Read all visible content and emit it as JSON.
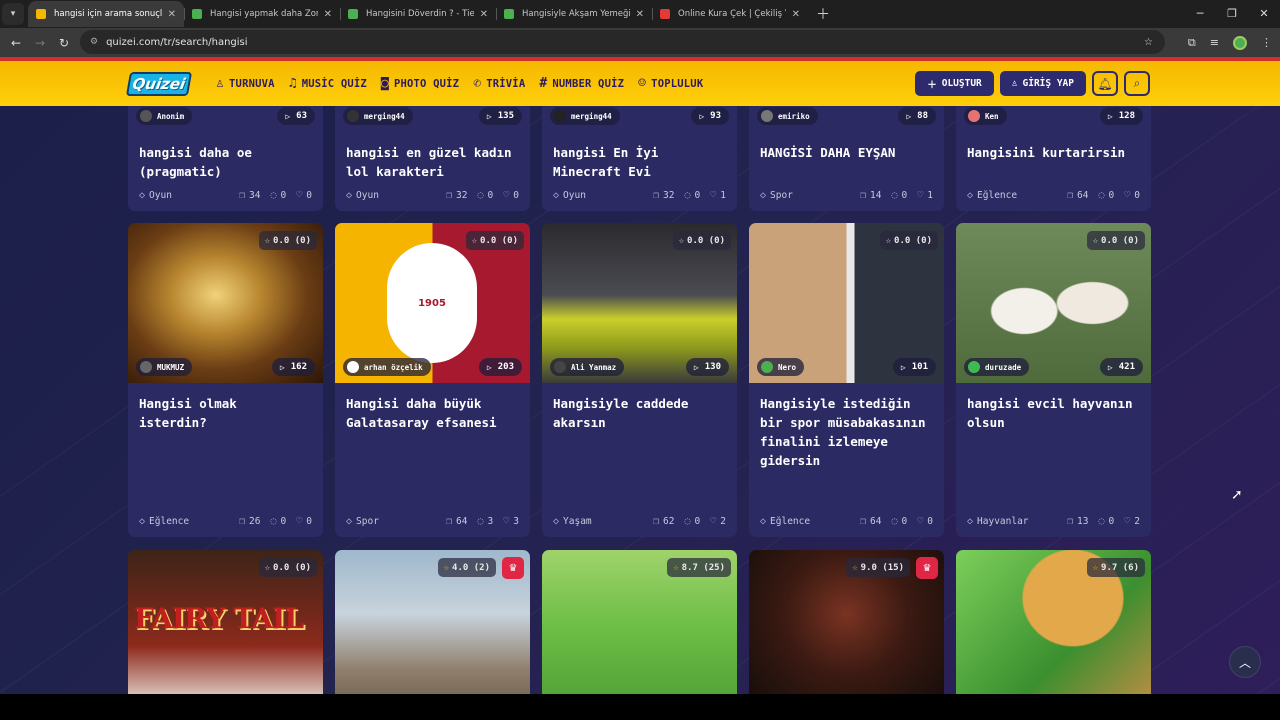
{
  "browser": {
    "tabs": [
      {
        "title": "hangisi için arama sonuçları - Q",
        "active": true,
        "favicon_color": "#f5b800"
      },
      {
        "title": "Hangisi yapmak daha Zor - Tier",
        "active": false,
        "favicon_color": "#4caf50"
      },
      {
        "title": "Hangisini Döverdin ? - Tier List",
        "active": false,
        "favicon_color": "#4caf50"
      },
      {
        "title": "Hangisiyle Akşam Yemeği - Tier",
        "active": false,
        "favicon_color": "#4caf50"
      },
      {
        "title": "Online Kura Çek | Çekiliş Yap",
        "active": false,
        "favicon_color": "#e53935"
      }
    ],
    "url": "quizei.com/tr/search/hangisi"
  },
  "header": {
    "logo": "Quizei",
    "nav": [
      {
        "label": "TURNUVA",
        "icon": "trophy-icon",
        "glyph": "♙"
      },
      {
        "label": "MUSİC QUİZ",
        "icon": "music-icon",
        "glyph": "♫"
      },
      {
        "label": "PHOTO QUİZ",
        "icon": "camera-icon",
        "glyph": "◙"
      },
      {
        "label": "TRİVİA",
        "icon": "chat-icon",
        "glyph": "✆"
      },
      {
        "label": "NUMBER QUİZ",
        "icon": "hash-icon",
        "glyph": "#"
      },
      {
        "label": "TOPLULUK",
        "icon": "users-icon",
        "glyph": "☺"
      }
    ],
    "create_label": "OLUŞTUR",
    "login_label": "GİRİŞ YAP"
  },
  "rows": [
    {
      "cards": [
        {
          "author": "Anonim",
          "plays": "63",
          "title": "hangisi daha oe (pragmatic)",
          "category": "Oyun",
          "questions": "34",
          "comments": "0",
          "likes": "0"
        },
        {
          "author": "merging44",
          "plays": "135",
          "title": "hangisi en güzel kadın lol karakteri",
          "category": "Oyun",
          "questions": "32",
          "comments": "0",
          "likes": "0"
        },
        {
          "author": "merging44",
          "plays": "93",
          "title": "hangisi En İyi Minecraft Evi",
          "category": "Oyun",
          "questions": "32",
          "comments": "0",
          "likes": "1"
        },
        {
          "author": "emiriko",
          "plays": "88",
          "title": "HANGİSİ DAHA EYŞAN",
          "category": "Spor",
          "questions": "14",
          "comments": "0",
          "likes": "1"
        },
        {
          "author": "Ken",
          "plays": "128",
          "title": "Hangisini kurtarirsin",
          "category": "Eğlence",
          "questions": "64",
          "comments": "0",
          "likes": "0"
        }
      ]
    },
    {
      "cards": [
        {
          "rating": "0.0",
          "votes": "(0)",
          "author": "MUKMUZ",
          "plays": "162",
          "title": "Hangisi olmak isterdin?",
          "category": "Eğlence",
          "questions": "26",
          "comments": "0",
          "likes": "0",
          "thumb": "fire"
        },
        {
          "rating": "0.0",
          "votes": "(0)",
          "author": "arhan özçelik",
          "plays": "203",
          "title": "Hangisi daha büyük Galatasaray efsanesi",
          "category": "Spor",
          "questions": "64",
          "comments": "3",
          "likes": "3",
          "thumb": "gs",
          "badge_year": "1905"
        },
        {
          "rating": "0.0",
          "votes": "(0)",
          "author": "Ali Yanmaz",
          "plays": "130",
          "title": "Hangisiyle caddede akarsın",
          "category": "Yaşam",
          "questions": "62",
          "comments": "0",
          "likes": "2",
          "thumb": "car"
        },
        {
          "rating": "0.0",
          "votes": "(0)",
          "author": "Nero",
          "plays": "101",
          "title": "Hangisiyle istediğin bir spor müsabakasının finalini izlemeye gidersin",
          "category": "Eğlence",
          "questions": "64",
          "comments": "0",
          "likes": "0",
          "thumb": "people"
        },
        {
          "rating": "0.0",
          "votes": "(0)",
          "author": "duruzade",
          "plays": "421",
          "title": "hangisi evcil hayvanın olsun",
          "category": "Hayvanlar",
          "questions": "13",
          "comments": "0",
          "likes": "2",
          "thumb": "sheep"
        }
      ]
    },
    {
      "cards": [
        {
          "rating": "0.0",
          "votes": "(0)",
          "thumb": "fairy",
          "thumb_text": "FAIRY TAIL"
        },
        {
          "rating": "4.0",
          "votes": "(2)",
          "crown": true,
          "thumb": "flag"
        },
        {
          "rating": "8.7",
          "votes": "(25)",
          "thumb": "cartoon"
        },
        {
          "rating": "9.0",
          "votes": "(15)",
          "crown": true,
          "thumb": "dark"
        },
        {
          "rating": "9.7",
          "votes": "(6)",
          "thumb": "food"
        }
      ]
    }
  ]
}
